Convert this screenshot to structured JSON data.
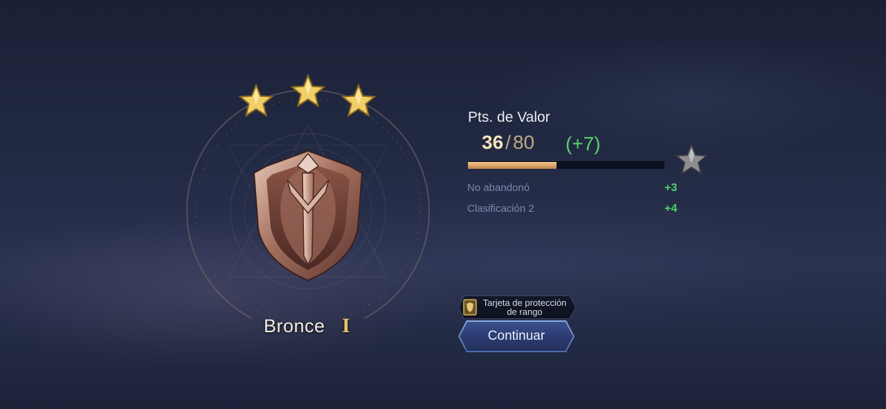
{
  "rank": {
    "name": "Bronce",
    "tier": "I",
    "stars_earned": 3
  },
  "valor": {
    "title": "Pts. de Valor",
    "current": "36",
    "separator": "/",
    "max": "80",
    "gain": "(+7)",
    "progress": 0.45
  },
  "bonuses": [
    {
      "label": "No abandonó",
      "value": "+3"
    },
    {
      "label": "Clasificación 2",
      "value": "+4"
    }
  ],
  "protection_card": {
    "label": "Tarjeta de protección de rango"
  },
  "continue_button": {
    "label": "Continuar"
  },
  "icons": {
    "rank_star": "gold-star-icon",
    "next_star": "silver-star-icon",
    "emblem": "bronze-shield-icon",
    "protection": "shield-card-icon"
  },
  "colors": {
    "gold": "#e8c466",
    "gain_green": "#58d36a",
    "progress_fill": "#d7a064",
    "button_blue": "#2b3b70"
  }
}
